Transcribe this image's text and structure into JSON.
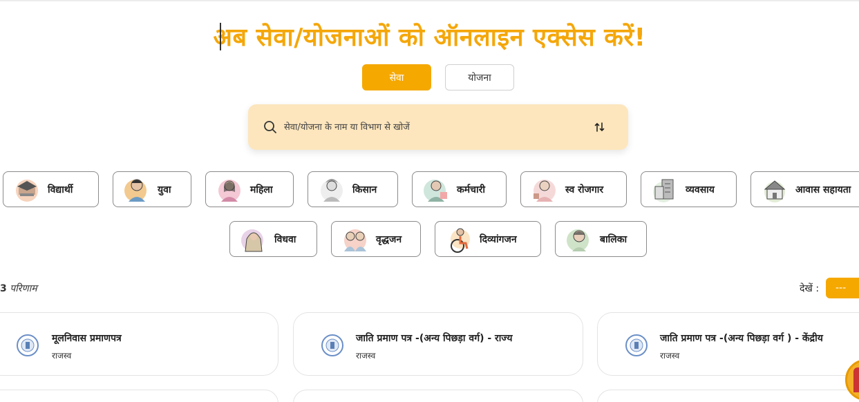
{
  "headline": "अब सेवा/योजनाओं को ऑनलाइन एक्सेस करें!",
  "tabs": {
    "seva": "सेवा",
    "yojana": "योजना"
  },
  "search": {
    "placeholder": "सेवा/योजना के नाम या विभाग से खोजें"
  },
  "categories": [
    {
      "label": "विद्यार्थी",
      "icon": "student-icon"
    },
    {
      "label": "युवा",
      "icon": "youth-icon"
    },
    {
      "label": "महिला",
      "icon": "woman-icon"
    },
    {
      "label": "किसान",
      "icon": "farmer-icon"
    },
    {
      "label": "कर्मचारी",
      "icon": "employee-icon"
    },
    {
      "label": "स्व रोजगार",
      "icon": "self-employment-icon"
    },
    {
      "label": "व्यवसाय",
      "icon": "business-icon"
    },
    {
      "label": "आवास सहायता",
      "icon": "housing-icon"
    },
    {
      "label": "विधवा",
      "icon": "widow-icon"
    },
    {
      "label": "वृद्धजन",
      "icon": "elderly-icon"
    },
    {
      "label": "दिव्यांगजन",
      "icon": "disabled-icon"
    },
    {
      "label": "बालिका",
      "icon": "girl-child-icon"
    }
  ],
  "results": {
    "count": "3",
    "label": "परिणाम",
    "view_label": "देखें :",
    "view_button": "---"
  },
  "cards": [
    {
      "title": "मूलनिवास प्रमाणपत्र",
      "dept": "राजस्व"
    },
    {
      "title": "जाति प्रमाण पत्र -(अन्य पिछड़ा वर्ग) - राज्य",
      "dept": "राजस्व"
    },
    {
      "title": "जाति प्रमाण पत्र -(अन्य पिछड़ा वर्ग ) - केंद्रीय",
      "dept": "राजस्व"
    }
  ],
  "colors": {
    "accent": "#f5a800",
    "headline": "#f4a70a",
    "search_bg": "#fde6bd"
  }
}
